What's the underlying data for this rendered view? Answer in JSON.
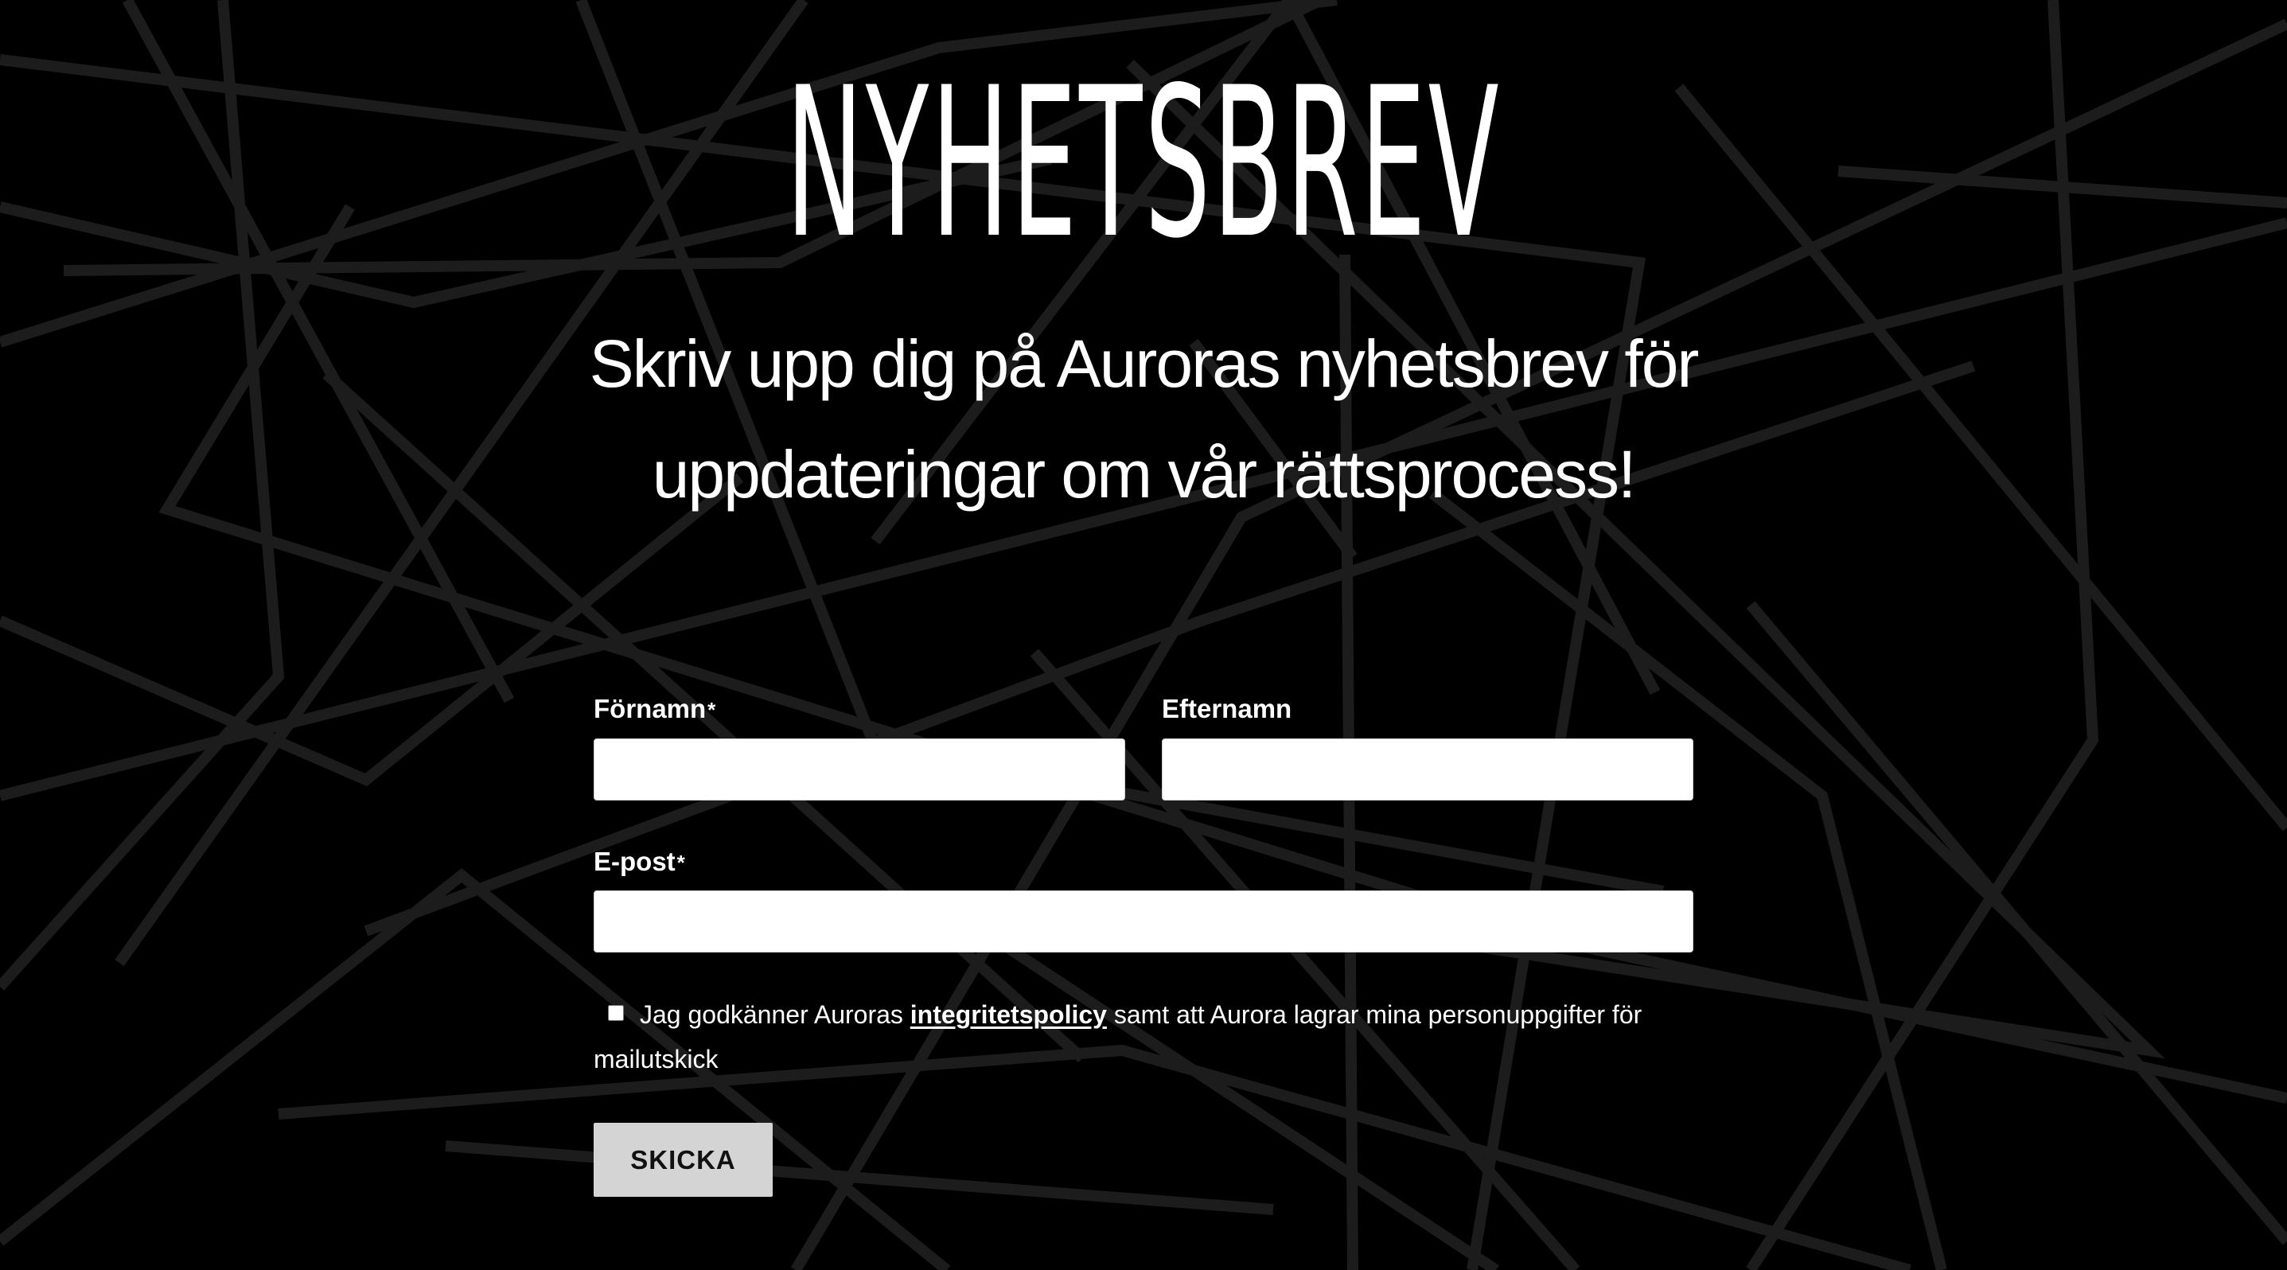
{
  "page": {
    "title": "NYHETSBREV",
    "subtitle_line1": "Skriv upp dig på Auroras nyhetsbrev för",
    "subtitle_line2": "uppdateringar om vår rättsprocess!"
  },
  "form": {
    "first_name": {
      "label": "Förnamn",
      "required_mark": "*",
      "value": ""
    },
    "last_name": {
      "label": "Efternamn",
      "value": ""
    },
    "email": {
      "label": "E-post",
      "required_mark": "*",
      "value": ""
    },
    "consent": {
      "checked": false,
      "text_before": "Jag godkänner Auroras",
      "link_text": "integritetspolicy",
      "text_after": "samt att Aurora lagrar mina personuppgifter för mailutskick"
    },
    "submit_label": "SKICKA"
  },
  "colors": {
    "background": "#000000",
    "lines": "#1c1c1c",
    "text": "#ffffff",
    "input_background": "#ffffff",
    "button_background": "#d4d4d4"
  }
}
